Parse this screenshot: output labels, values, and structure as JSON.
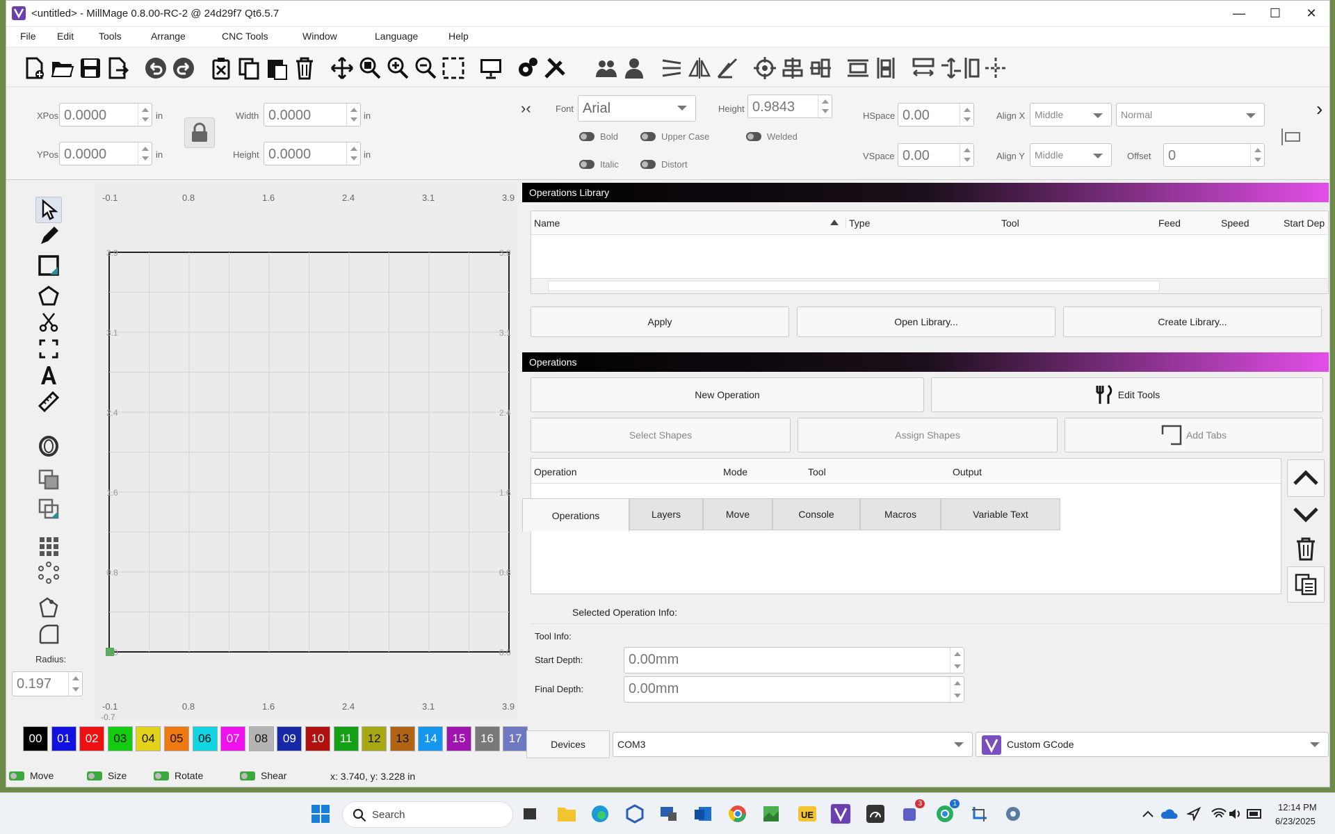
{
  "window": {
    "title": "<untitled> - MillMage 0.8.00-RC-2 @ 24d29f7 Qt6.5.7",
    "minimize": "—",
    "maximize": "☐",
    "close": "✕"
  },
  "menu": [
    "File",
    "Edit",
    "Tools",
    "Arrange",
    "CNC Tools",
    "Window",
    "Language",
    "Help"
  ],
  "toolbar": {
    "icons": [
      "new-file-icon",
      "open-folder-icon",
      "save-icon",
      "export-icon",
      "undo-icon",
      "redo-icon",
      "cut-icon",
      "copy-icon",
      "paste-icon",
      "delete-icon",
      "move-icon",
      "zoom-fit-icon",
      "zoom-in-icon",
      "zoom-out-icon",
      "select-frame-icon",
      "monitor-icon",
      "settings-gear-icon",
      "tools-wrench-icon",
      "group-icon",
      "ungroup-icon",
      "mirror-h-icon",
      "mirror-v-icon",
      "rotate-icon",
      "target-icon",
      "align-icon",
      "distribute-icon",
      "align-center-icon",
      "spacing-icon",
      "width-icon",
      "height-icon",
      "dock-icon",
      "anchor-icon"
    ]
  },
  "props": {
    "xpos_label": "XPos",
    "xpos": "0.0000",
    "ypos_label": "YPos",
    "ypos": "0.0000",
    "unit": "in",
    "width_label": "Width",
    "width": "0.0000",
    "height_label": "Height",
    "height": "0.0000",
    "font_label": "Font",
    "font": "Arial",
    "font_height_label": "Height",
    "font_height": "0.9843",
    "bold": "Bold",
    "upper": "Upper Case",
    "welded": "Welded",
    "italic": "Italic",
    "distort": "Distort",
    "hspace_label": "HSpace",
    "hspace": "0.00",
    "vspace_label": "VSpace",
    "vspace": "0.00",
    "alignx_label": "Align X",
    "alignx": "Middle",
    "aligny_label": "Align Y",
    "aligny": "Middle",
    "mode": "Normal",
    "offset_label": "Offset",
    "offset": "0"
  },
  "left_tools": {
    "radius_label": "Radius:",
    "radius": "0.197"
  },
  "canvas": {
    "top_ticks": [
      "-0.1",
      "0.8",
      "1.6",
      "2.4",
      "3.1",
      "3.9"
    ],
    "left_ticks": [
      "3.9",
      "3.1",
      "2.4",
      "1.6",
      "0.8",
      "0.0"
    ],
    "bottom_ticks": [
      "-0.1",
      "0.8",
      "1.6",
      "2.4",
      "3.1",
      "3.9"
    ],
    "right_ticks": [
      "3.9",
      "3.1",
      "2.4",
      "1.6",
      "0.8",
      "0.0"
    ],
    "bottom_partial": "-0.7"
  },
  "ops_library": {
    "title": "Operations Library",
    "columns": [
      "Name",
      "Type",
      "Tool",
      "Feed",
      "Speed",
      "Start Dep"
    ],
    "apply": "Apply",
    "open": "Open Library...",
    "create": "Create Library..."
  },
  "operations": {
    "title": "Operations",
    "new_op": "New Operation",
    "edit_tools": "Edit Tools",
    "select_shapes": "Select Shapes",
    "assign_shapes": "Assign Shapes",
    "add_tabs": "Add Tabs",
    "columns": [
      "Operation",
      "Mode",
      "Tool",
      "Output"
    ],
    "tabs": [
      "Operations",
      "Layers",
      "Move",
      "Console",
      "Macros",
      "Variable Text"
    ],
    "selected_info": "Selected Operation Info:",
    "tool_info": "Tool Info:",
    "start_depth_label": "Start Depth:",
    "start_depth": "0.00mm",
    "final_depth_label": "Final Depth:",
    "final_depth": "0.00mm"
  },
  "palette": [
    {
      "n": "00",
      "c": "#000000",
      "t": "#ffffff"
    },
    {
      "n": "01",
      "c": "#1010e0",
      "t": "#ffffff"
    },
    {
      "n": "02",
      "c": "#ee1111",
      "t": "#ffffff"
    },
    {
      "n": "03",
      "c": "#11cc11",
      "t": "#111111"
    },
    {
      "n": "04",
      "c": "#e2d21a",
      "t": "#111111"
    },
    {
      "n": "05",
      "c": "#f07a11",
      "t": "#111111"
    },
    {
      "n": "06",
      "c": "#11d6e2",
      "t": "#111111"
    },
    {
      "n": "07",
      "c": "#ee11ee",
      "t": "#ffffff"
    },
    {
      "n": "08",
      "c": "#b4b4b4",
      "t": "#111111"
    },
    {
      "n": "09",
      "c": "#1428a8",
      "t": "#ffffff"
    },
    {
      "n": "10",
      "c": "#b01010",
      "t": "#ffffff"
    },
    {
      "n": "11",
      "c": "#14a014",
      "t": "#ffffff"
    },
    {
      "n": "12",
      "c": "#a8a814",
      "t": "#111111"
    },
    {
      "n": "13",
      "c": "#b06414",
      "t": "#111111"
    },
    {
      "n": "14",
      "c": "#1496ee",
      "t": "#ffffff"
    },
    {
      "n": "15",
      "c": "#a014b0",
      "t": "#ffffff"
    },
    {
      "n": "16",
      "c": "#787878",
      "t": "#ffffff"
    },
    {
      "n": "17",
      "c": "#6e78c0",
      "t": "#ffffff"
    }
  ],
  "devices": {
    "devices_btn": "Devices",
    "port": "COM3",
    "profile": "Custom GCode"
  },
  "status": {
    "move": "Move",
    "size": "Size",
    "rotate": "Rotate",
    "shear": "Shear",
    "coords": "x: 3.740, y: 3.228 in"
  },
  "taskbar": {
    "search": "Search",
    "time": "12:14 PM",
    "date": "6/23/2025",
    "badge1": "3",
    "badge2": "1"
  }
}
